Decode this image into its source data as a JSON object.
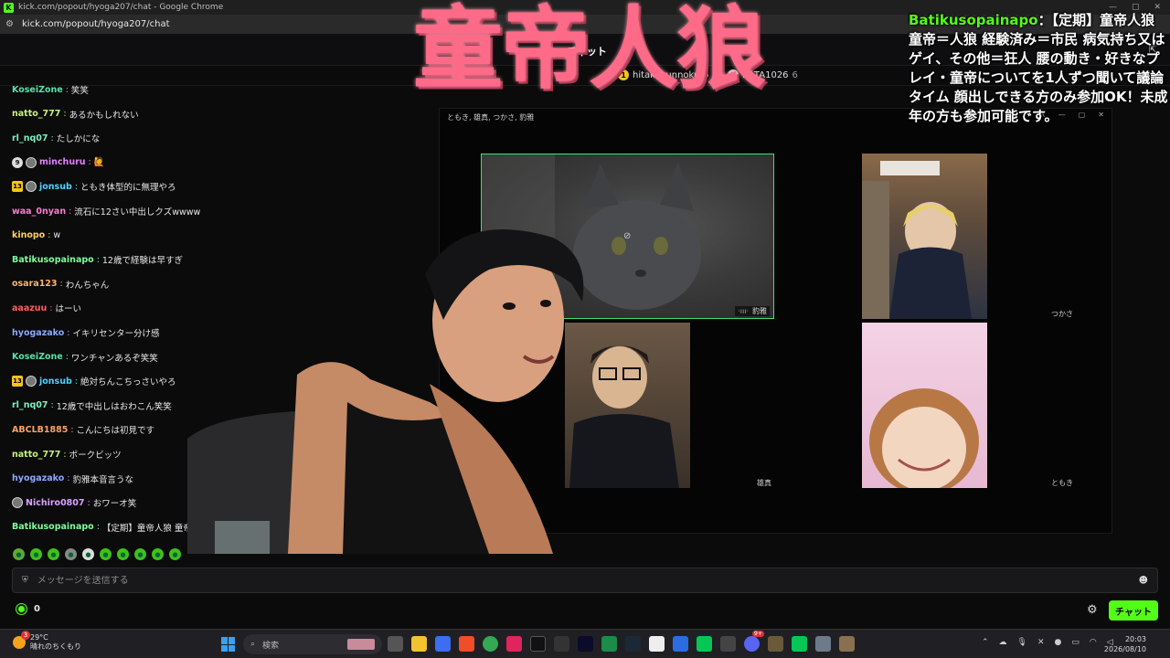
{
  "browser": {
    "window_title": "kick.com/popout/hyoga207/chat - Google Chrome",
    "url": "kick.com/popout/hyoga207/chat",
    "logo_letter": "K"
  },
  "chat_header": {
    "label": "チャット"
  },
  "top_gifters": [
    {
      "rank": "1",
      "name": "hitakakunnokuro",
      "count": "5"
    },
    {
      "rank": "2",
      "name": "BATA1026",
      "count": "6"
    }
  ],
  "overlay": {
    "big_title": "童帝人狼",
    "topic_user": "Batikusopainapo",
    "topic_text": "：【定期】童帝人狼 童帝＝人狼 経験済み＝市民 病気持ち又はゲイ、その他＝狂人 腰の動き・好きなプレイ・童帝についてを1人ずつ聞いて議論タイム 顔出しできる方のみ参加OK！未成年の方も参加可能です。"
  },
  "messages": [
    {
      "user": "KoseiZone",
      "color": "#58e0a8",
      "text": "笑笑",
      "badges": []
    },
    {
      "user": "natto_777",
      "color": "#c8f27a",
      "text": "あるかもしれない",
      "badges": []
    },
    {
      "user": "rl_nq07",
      "color": "#7ef0c0",
      "text": "たしかにな",
      "badges": []
    },
    {
      "user": "minchuru",
      "color": "#e080ff",
      "text": "🙋",
      "badges": [
        "round:9",
        "avatar"
      ]
    },
    {
      "user": "jonsub",
      "color": "#4fd0ff",
      "text": "ともき体型的に無理やろ",
      "badges": [
        "sub:13",
        "avatar"
      ]
    },
    {
      "user": "waa_0nyan",
      "color": "#ff7ad0",
      "text": "流石に12さい中出しクズwwww",
      "badges": []
    },
    {
      "user": "kinopo",
      "color": "#ffd060",
      "text": "w",
      "badges": []
    },
    {
      "user": "Batikusopainapo",
      "color": "#7dfc9a",
      "text": "12歳で経験は早すぎ",
      "badges": []
    },
    {
      "user": "osara123",
      "color": "#ffb36b",
      "text": "わんちゃん",
      "badges": []
    },
    {
      "user": "aaazuu",
      "color": "#ff5c5c",
      "text": "はーい",
      "badges": []
    },
    {
      "user": "hyogazako",
      "color": "#8ca8ff",
      "text": "イキリセンター分け感",
      "badges": []
    },
    {
      "user": "KoseiZone",
      "color": "#58e0a8",
      "text": "ワンチャンあるぞ笑笑",
      "badges": []
    },
    {
      "user": "jonsub",
      "color": "#4fd0ff",
      "text": "絶対ちんこちっさいやろ",
      "badges": [
        "sub:13",
        "avatar"
      ]
    },
    {
      "user": "rl_nq07",
      "color": "#7ef0c0",
      "text": "12歳で中出しはおわこん笑笑",
      "badges": []
    },
    {
      "user": "ABCLB1885",
      "color": "#ffa060",
      "text": "こんにちは初見です",
      "badges": []
    },
    {
      "user": "natto_777",
      "color": "#c8f27a",
      "text": "ポークビッツ",
      "badges": []
    },
    {
      "user": "hyogazako",
      "color": "#8ca8ff",
      "text": "豹雅本音言うな",
      "badges": []
    },
    {
      "user": "Nichiro0807",
      "color": "#d8a0ff",
      "text": "おワーオ笑",
      "badges": [
        "avatar"
      ]
    },
    {
      "user": "Batikusopainapo",
      "color": "#7dfc9a",
      "text": "【定期】童帝人狼 童帝＝人",
      "badges": []
    }
  ],
  "chat_input": {
    "placeholder": "メッセージを送信する"
  },
  "bottom": {
    "points": "0",
    "send_label": "チャット"
  },
  "call_window": {
    "title": "ともき, 雄真, つかさ, 豹雅",
    "tiles": [
      {
        "name": "豹雅",
        "muted_label": "·ııı·"
      },
      {
        "name": "つかさ"
      },
      {
        "name": "雄真"
      },
      {
        "name": "ともき"
      }
    ]
  },
  "taskbar": {
    "weather_temp": "29°C",
    "weather_desc": "晴れのちくもり",
    "weather_badge": "3",
    "search_placeholder": "検索",
    "time": "20:03",
    "date": "2026/08/10",
    "discord_badge": "9+"
  }
}
